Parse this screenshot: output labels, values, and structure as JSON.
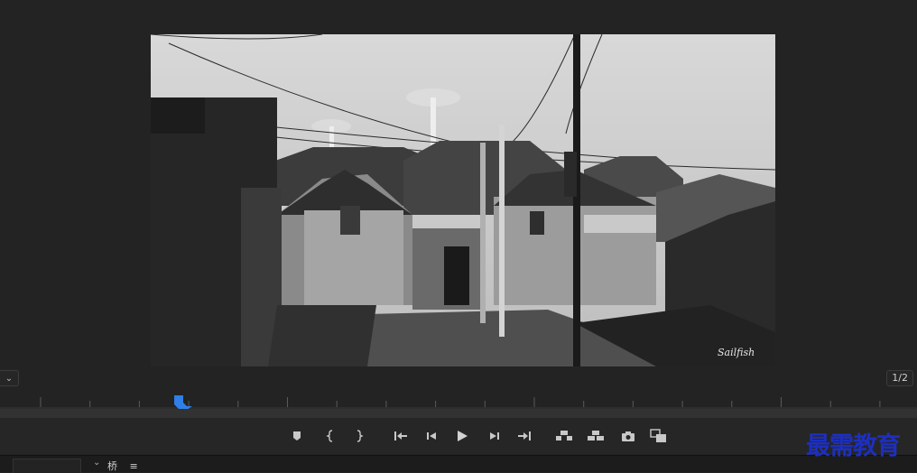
{
  "program_monitor": {
    "scale_dropdown_glyph": "⌄",
    "resolution": "1/2",
    "image_signature": "Sailfish"
  },
  "timeline": {
    "playhead_color": "#2f7fe6"
  },
  "transport": {
    "buttons": [
      {
        "name": "add-marker-button",
        "icon": "marker-icon"
      },
      {
        "name": "mark-in-button",
        "icon": "mark-in-icon"
      },
      {
        "name": "mark-out-button",
        "icon": "mark-out-icon"
      },
      {
        "name": "go-to-in-button",
        "icon": "go-to-in-icon"
      },
      {
        "name": "step-back-button",
        "icon": "step-back-icon"
      },
      {
        "name": "play-button",
        "icon": "play-icon"
      },
      {
        "name": "step-forward-button",
        "icon": "step-forward-icon"
      },
      {
        "name": "go-to-out-button",
        "icon": "go-to-out-icon"
      },
      {
        "name": "lift-button",
        "icon": "lift-icon"
      },
      {
        "name": "extract-button",
        "icon": "extract-icon"
      },
      {
        "name": "export-frame-button",
        "icon": "camera-icon"
      },
      {
        "name": "comparison-view-button",
        "icon": "compare-icon"
      }
    ]
  },
  "bottom_panel": {
    "tab_chevron": "⌄",
    "tab_label": "桥",
    "tab_menu_glyph": "≡"
  },
  "watermark": "最需教育"
}
